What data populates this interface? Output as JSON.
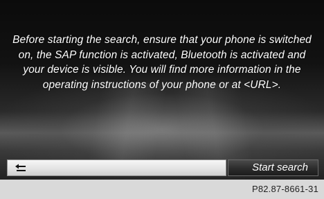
{
  "dialog": {
    "message": "Before starting the search, ensure that your phone is switched on, the SAP function is activated, Bluetooth is activated and your device is visible. You will find more information in the operating instructions of your phone or at <URL>."
  },
  "buttons": {
    "back_icon": "back-arrow-icon",
    "start_search_label": "Start search"
  },
  "footer": {
    "figure_code": "P82.87-8661-31"
  }
}
